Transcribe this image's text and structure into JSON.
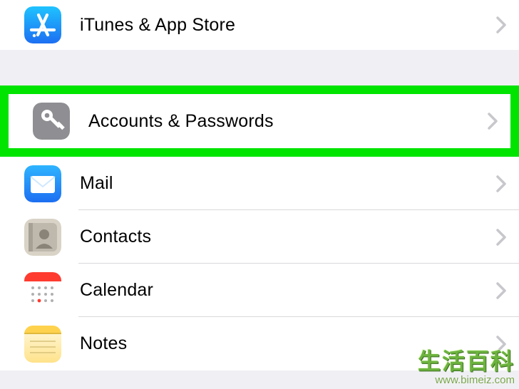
{
  "sections": [
    {
      "items": [
        {
          "key": "itunes",
          "label": "iTunes & App Store",
          "icon": "app-store-icon"
        }
      ]
    },
    {
      "items": [
        {
          "key": "accounts",
          "label": "Accounts & Passwords",
          "icon": "key-icon",
          "highlighted": true
        },
        {
          "key": "mail",
          "label": "Mail",
          "icon": "mail-icon"
        },
        {
          "key": "contacts",
          "label": "Contacts",
          "icon": "contacts-icon"
        },
        {
          "key": "calendar",
          "label": "Calendar",
          "icon": "calendar-icon"
        },
        {
          "key": "notes",
          "label": "Notes",
          "icon": "notes-icon"
        }
      ]
    }
  ],
  "watermark": {
    "title": "生活百科",
    "url": "www.bimeiz.com"
  },
  "colors": {
    "highlight": "#00e400",
    "rowBg": "#ffffff",
    "gapBg": "#efeff4",
    "chevron": "#c7c7cc"
  }
}
